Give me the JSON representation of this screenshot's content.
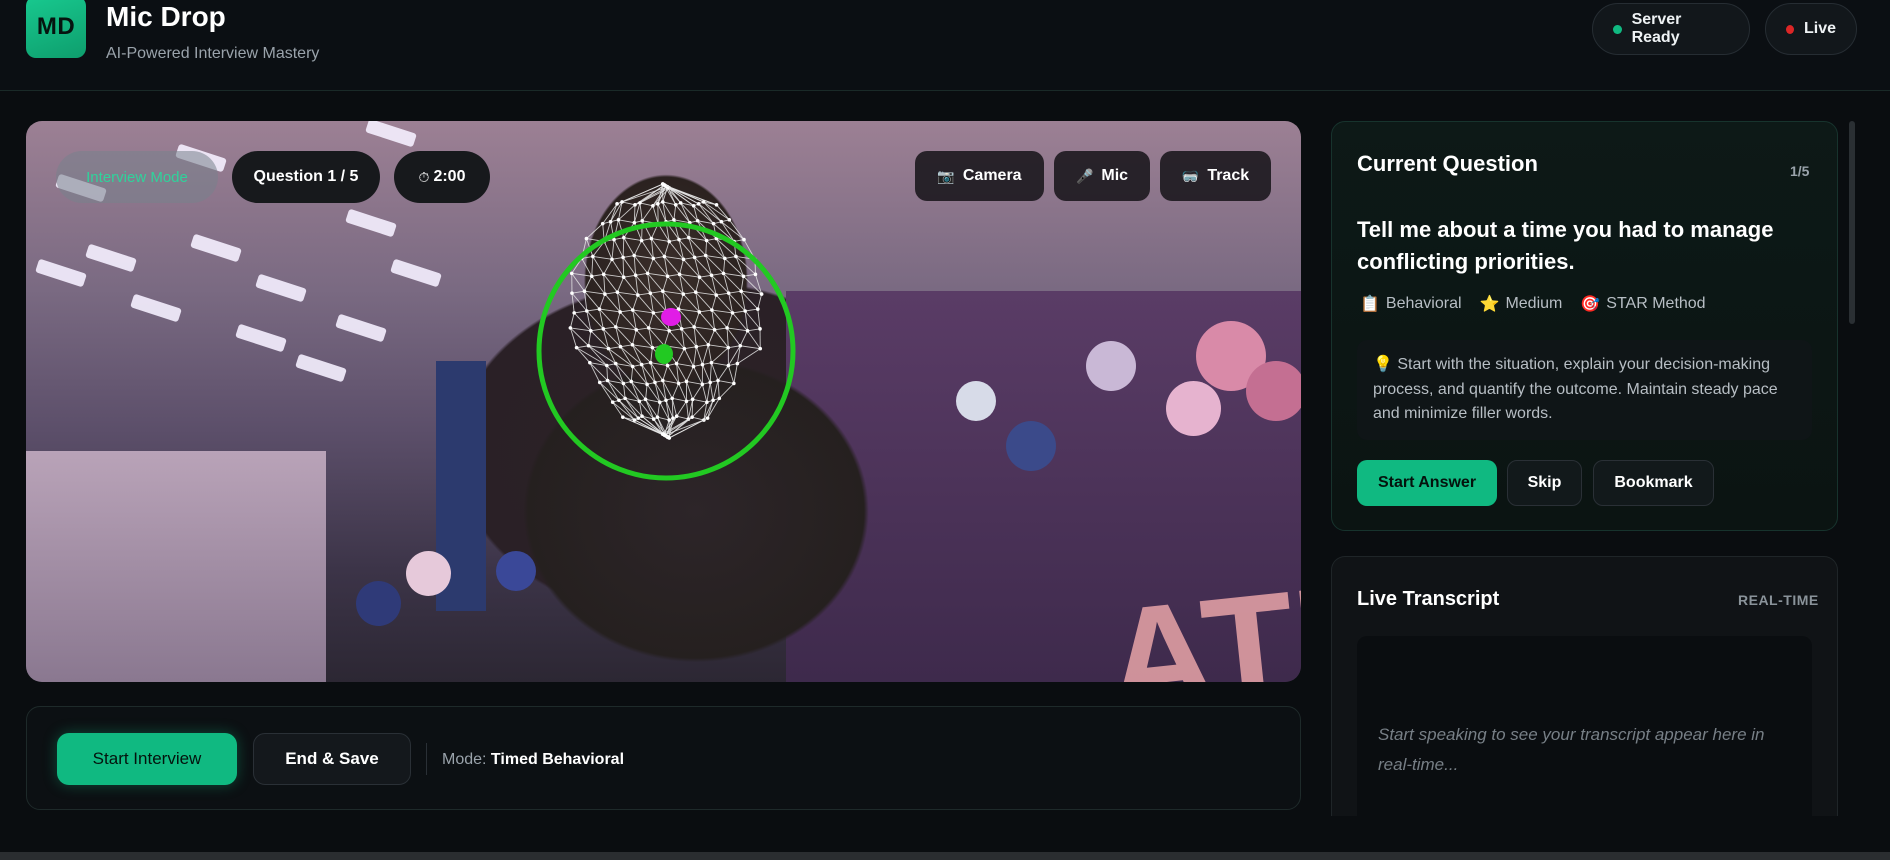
{
  "header": {
    "logo_text": "MD",
    "title": "Mic Drop",
    "subtitle": "AI-Powered Interview Mastery",
    "status_server": "Server Ready",
    "status_live": "Live",
    "colors": {
      "accent": "#10b981",
      "server_dot": "#10b981",
      "live_dot": "#dc2626"
    }
  },
  "video": {
    "mode_chip": "Interview Mode",
    "question_chip": "Question 1 / 5",
    "timer_icon": "⏱",
    "timer_chip": "2:00",
    "controls": [
      {
        "icon": "📷",
        "icon_name": "camera-icon",
        "label": "Camera"
      },
      {
        "icon": "🎤",
        "icon_name": "mic-icon",
        "label": "Mic"
      },
      {
        "icon": "🥽",
        "icon_name": "track-icon",
        "label": "Track"
      }
    ],
    "overlay_colors": {
      "face_mesh": "#e6e6e6",
      "tracking_ring": "#22c922",
      "nose_marker": "#e11de6",
      "mouth_marker": "#22c922"
    }
  },
  "controls": {
    "start_interview": "Start Interview",
    "end_save": "End & Save",
    "mode_label": "Mode:",
    "mode_value": "Timed Behavioral"
  },
  "question": {
    "heading": "Current Question",
    "count": "1/5",
    "text": "Tell me about a time you had to manage conflicting priorities.",
    "tags": [
      {
        "icon": "📋",
        "icon_name": "clipboard-icon",
        "label": "Behavioral"
      },
      {
        "icon": "⭐",
        "icon_name": "star-icon",
        "label": "Medium"
      },
      {
        "icon": "🎯",
        "icon_name": "target-icon",
        "label": "STAR Method"
      }
    ],
    "tip_icon": "💡",
    "tip": "Start with the situation, explain your decision-making process, and quantify the outcome. Maintain steady pace and minimize filler words.",
    "buttons": {
      "start_answer": "Start Answer",
      "skip": "Skip",
      "bookmark": "Bookmark"
    }
  },
  "transcript": {
    "heading": "Live Transcript",
    "badge": "REAL-TIME",
    "placeholder": "Start speaking to see your transcript appear here in real-time..."
  }
}
